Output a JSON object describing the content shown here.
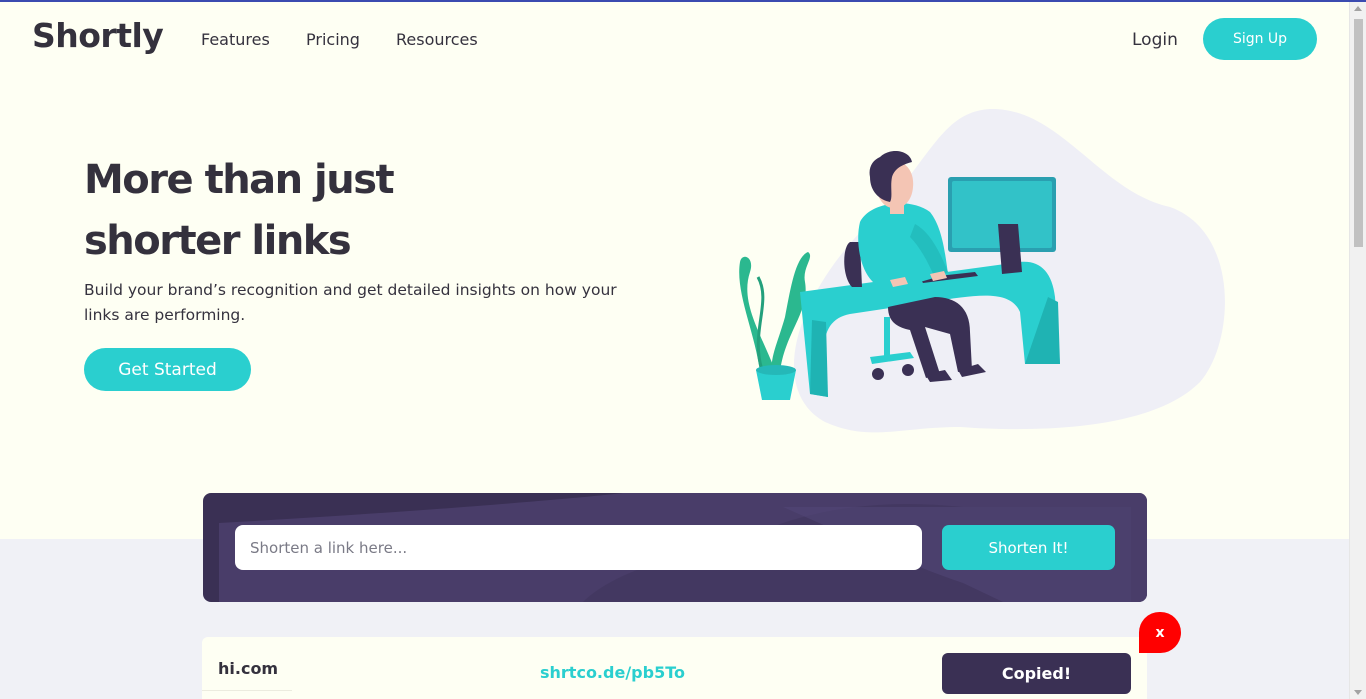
{
  "brand": {
    "logo": "Shortly",
    "accent": "#2acfcf",
    "dark": "#3a3054"
  },
  "nav": {
    "links": [
      "Features",
      "Pricing",
      "Resources"
    ],
    "login": "Login",
    "signup": "Sign Up"
  },
  "hero": {
    "title_line1": "More than just",
    "title_line2": "shorter links",
    "subtitle": "Build your brand’s recognition and get detailed insights on how your links are performing.",
    "cta": "Get Started"
  },
  "shortener": {
    "placeholder": "Shorten a link here...",
    "button": "Shorten It!"
  },
  "results": [
    {
      "original": "hi.com",
      "short": "shrtco.de/pb5To",
      "button": "Copied!"
    }
  ],
  "close_label": "x"
}
